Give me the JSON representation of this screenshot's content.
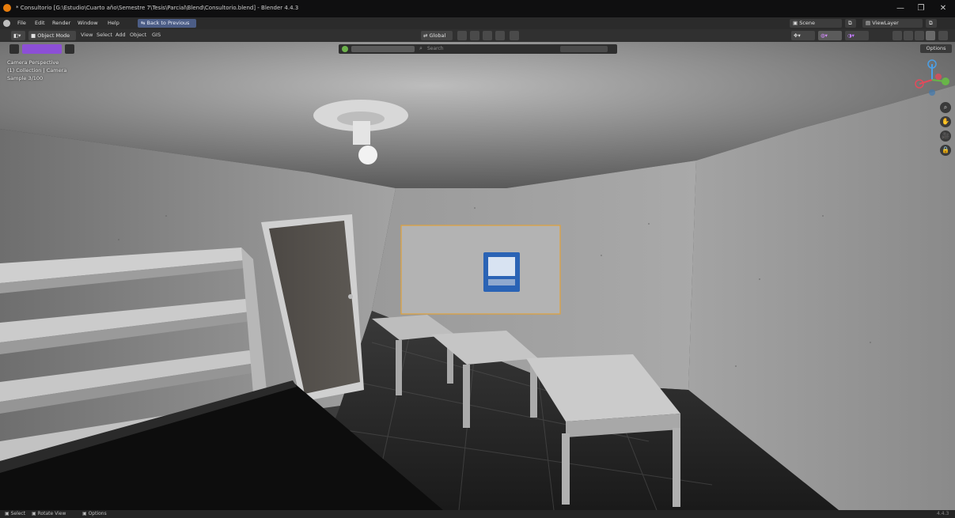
{
  "window": {
    "title": "* Consultorio [G:\\Estudio\\Cuarto año\\Semestre 7\\Tesis\\Parcial\\Blend\\Consultorio.blend] - Blender 4.4.3",
    "minimize": "—",
    "maximize": "❐",
    "close": "✕"
  },
  "menubar": {
    "items": [
      "File",
      "Edit",
      "Render",
      "Window",
      "Help"
    ],
    "back_button": "Back to Previous",
    "scene": "Scene",
    "view_layer": "ViewLayer"
  },
  "header": {
    "mode": "Object Mode",
    "menus": [
      "View",
      "Select",
      "Add",
      "Object",
      "GIS"
    ],
    "transform_orientation": "Global",
    "search_placeholder": "Search",
    "options": "Options"
  },
  "viewport": {
    "camera_label": "Camera Perspective",
    "collection_label": "(1) Collection | Camera",
    "sample_label": "Sample 3/100"
  },
  "statusbar": {
    "items": [
      "Select",
      "Rotate View",
      "Options"
    ],
    "version": "4.4.3"
  },
  "colors": {
    "active_selection": "#e0a23a",
    "sign_blue": "#2a63b5"
  }
}
